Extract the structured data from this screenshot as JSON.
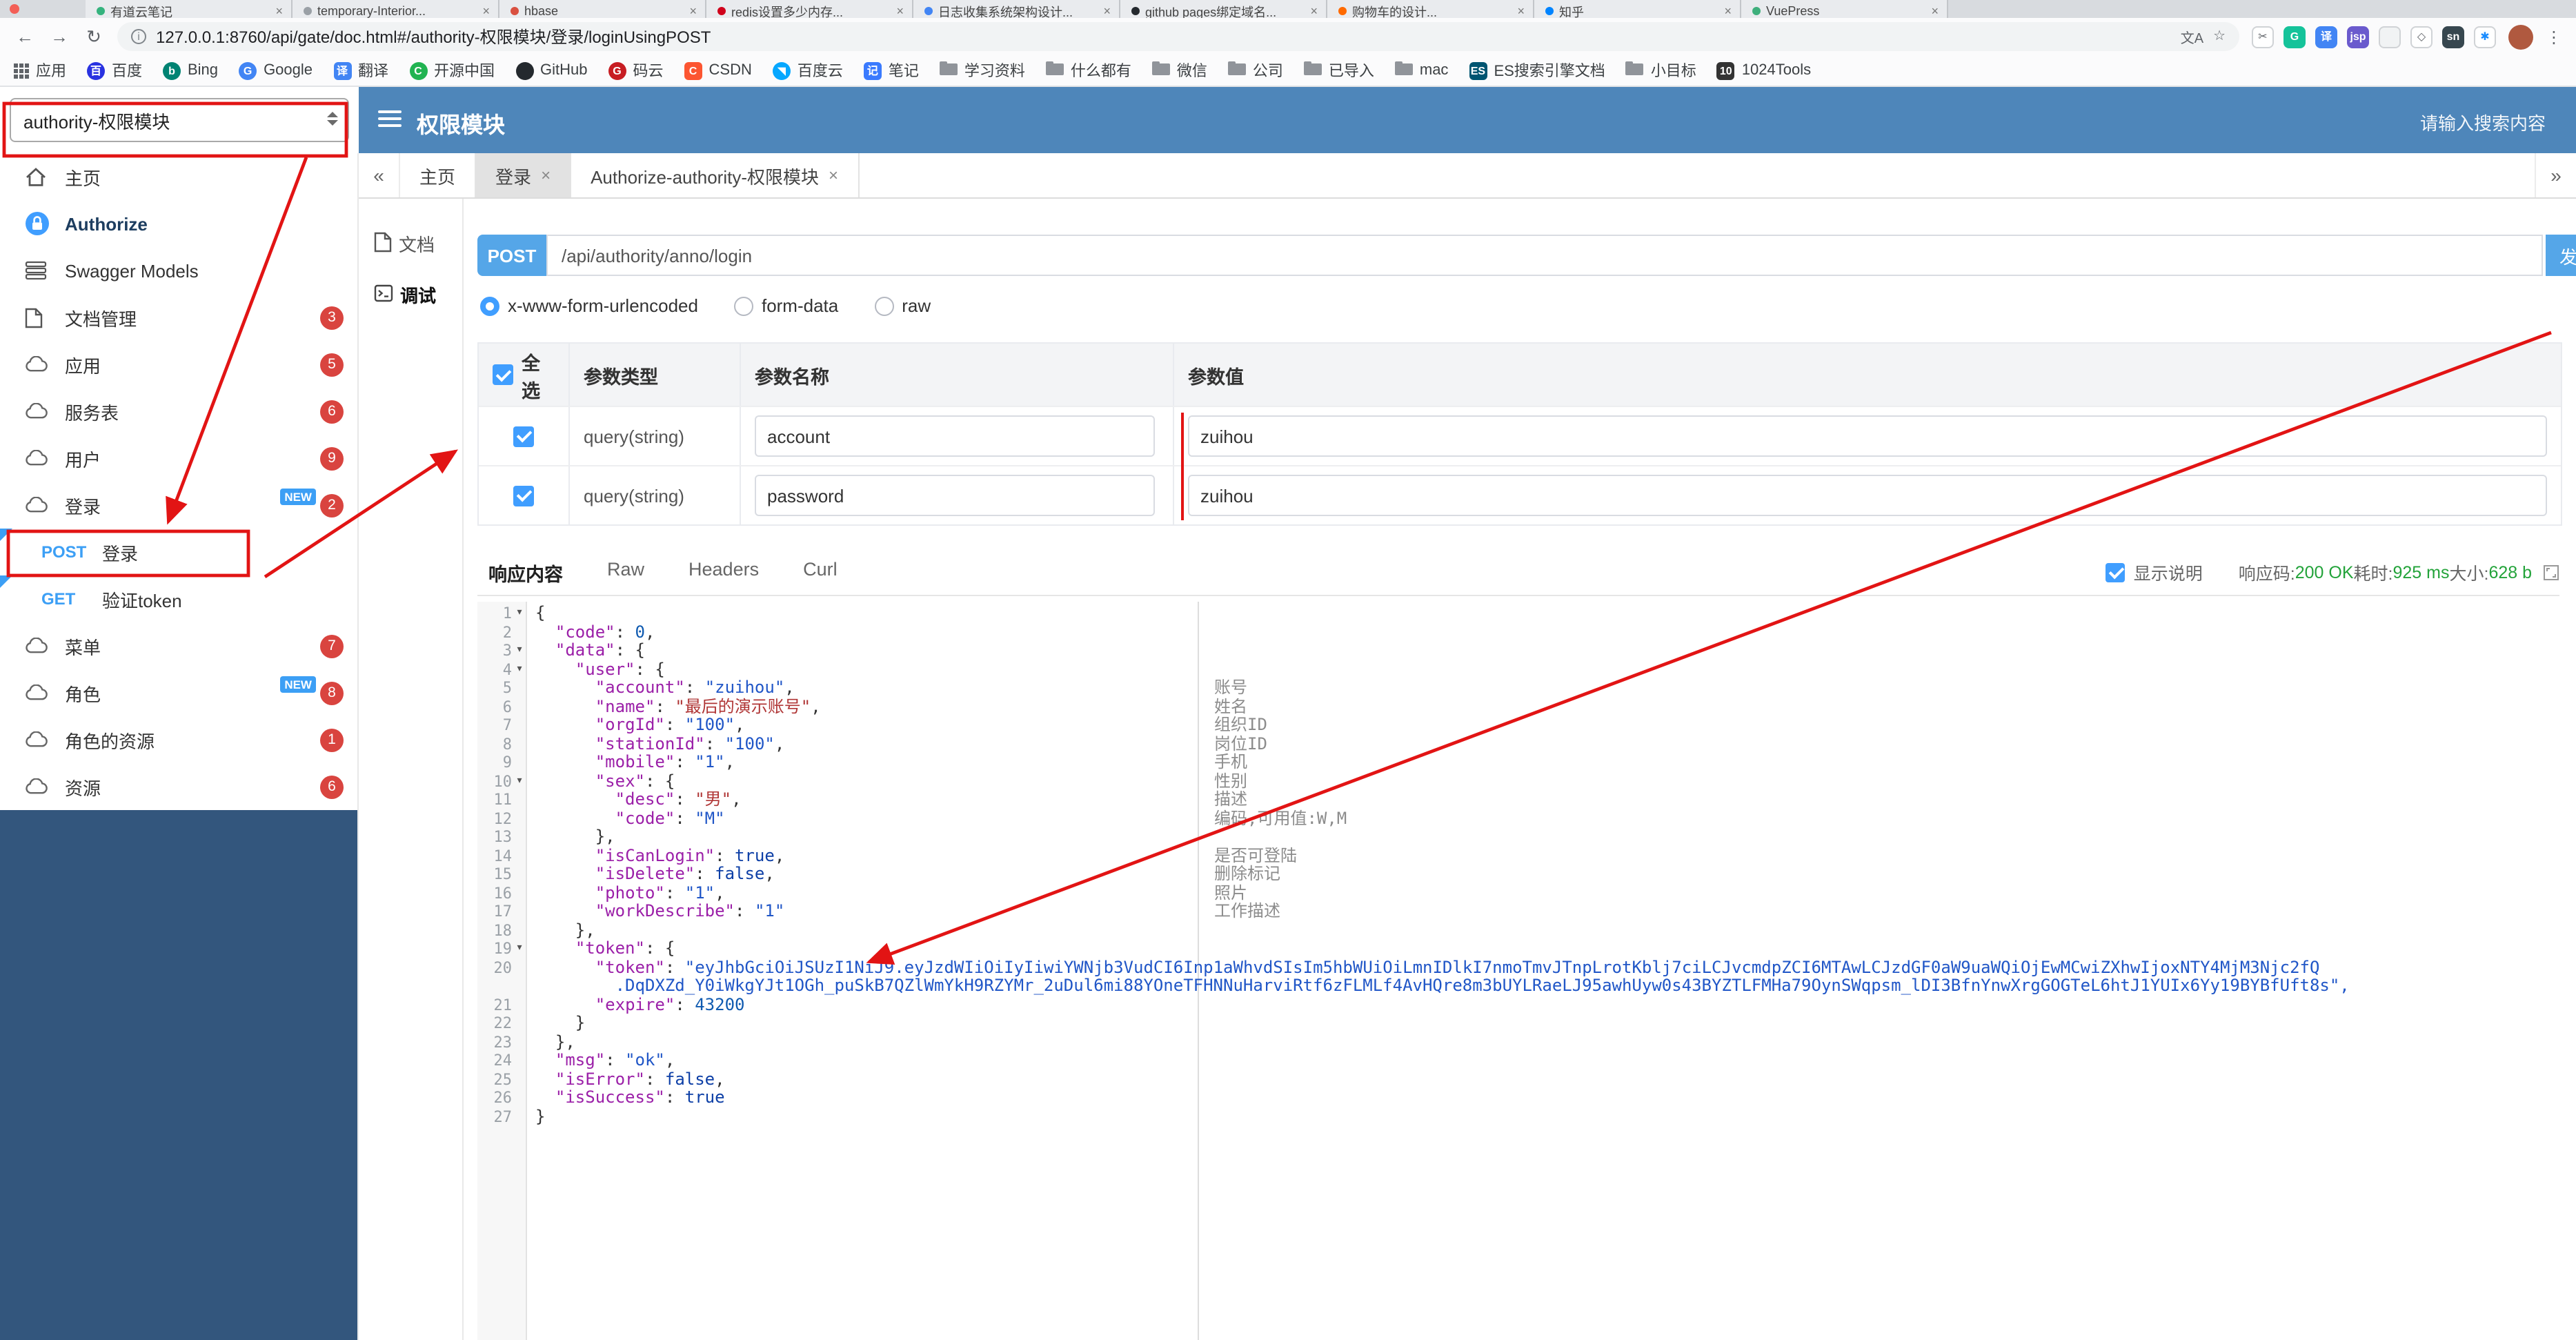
{
  "colors": {
    "accent": "#409eff",
    "post_blue": "#55a6e8",
    "header_bg": "#4e86ba",
    "sidebar_dark": "#33567d",
    "badge_red": "#d9443f",
    "new_blue": "#3c9ff5",
    "annotation_red": "#e21414",
    "success_green": "#23a33a",
    "code_key": "#9b1fa8",
    "code_str": "#2056c7",
    "code_cjk": "#b03636",
    "code_num": "#0f5ab0",
    "code_bool": "#0d3fa6"
  },
  "browser": {
    "url": "127.0.0.1:8760/api/gate/doc.html#/authority-权限模块/登录/loginUsingPOST",
    "tabs": [
      {
        "color": "#35b37e",
        "title": "有道云笔记"
      },
      {
        "color": "#9aa0a6",
        "title": "temporary-Interior..."
      },
      {
        "color": "#d95040",
        "title": "hbase"
      },
      {
        "color": "#d0021b",
        "title": "redis设置多少内存..."
      },
      {
        "color": "#4285f4",
        "title": "日志收集系统架构设计..."
      },
      {
        "color": "#24292e",
        "title": "github pages绑定域名..."
      },
      {
        "color": "#ff6a00",
        "title": "购物车的设计..."
      },
      {
        "color": "#0084ff",
        "title": "知乎"
      },
      {
        "color": "#3eaf7c",
        "title": "VuePress"
      }
    ],
    "toolbar": {
      "back": "←",
      "forward": "→",
      "reload": "↻",
      "translate_icon": "文A",
      "star_icon": "☆",
      "menu_icon": "⋮",
      "extensions": [
        {
          "name": "screenshot-icon",
          "glyph": "✂",
          "bg": "#ffffff",
          "fg": "#5f6368",
          "border": true
        },
        {
          "name": "grammarly-icon",
          "glyph": "G",
          "bg": "#15c39a",
          "fg": "#ffffff"
        },
        {
          "name": "translate-ext-icon",
          "glyph": "译",
          "bg": "#4285f4",
          "fg": "#ffffff"
        },
        {
          "name": "jsp-icon",
          "glyph": "jsp",
          "bg": "#6a5acd",
          "fg": "#ffffff"
        },
        {
          "name": "dot-icon",
          "glyph": "",
          "bg": "#f1f3f4",
          "fg": "#5f6368",
          "border": true
        },
        {
          "name": "shield-icon",
          "glyph": "◇",
          "bg": "#ffffff",
          "fg": "#5f6368",
          "border": true
        },
        {
          "name": "snip-icon",
          "glyph": "sn",
          "bg": "#37474f",
          "fg": "#ffffff"
        },
        {
          "name": "pinwheel-icon",
          "glyph": "✱",
          "bg": "#ffffff",
          "fg": "#1a8cff",
          "border": true
        }
      ]
    },
    "bookmarks": [
      {
        "type": "grid",
        "label": "应用"
      },
      {
        "type": "circle",
        "color": "#2932e1",
        "glyph": "百",
        "label": "百度"
      },
      {
        "type": "circle",
        "color": "#008373",
        "glyph": "b",
        "label": "Bing"
      },
      {
        "type": "circle",
        "color": "#4285f4",
        "glyph": "G",
        "label": "Google"
      },
      {
        "type": "square",
        "color": "#4285f4",
        "glyph": "译",
        "label": "翻译"
      },
      {
        "type": "circle",
        "color": "#21b351",
        "glyph": "C",
        "label": "开源中国"
      },
      {
        "type": "circle",
        "color": "#24292e",
        "glyph": "",
        "label": "GitHub"
      },
      {
        "type": "circle",
        "color": "#c71d23",
        "glyph": "G",
        "label": "码云"
      },
      {
        "type": "square",
        "color": "#fc5531",
        "glyph": "C",
        "label": "CSDN"
      },
      {
        "type": "circle",
        "color": "#06a7ff",
        "glyph": "◥",
        "label": "百度云"
      },
      {
        "type": "square",
        "color": "#3a7afe",
        "glyph": "记",
        "label": "笔记"
      },
      {
        "type": "folder",
        "label": "学习资料"
      },
      {
        "type": "folder",
        "label": "什么都有"
      },
      {
        "type": "folder",
        "label": "微信"
      },
      {
        "type": "folder",
        "label": "公司"
      },
      {
        "type": "folder",
        "label": "已导入"
      },
      {
        "type": "folder",
        "label": "mac"
      },
      {
        "type": "square",
        "color": "#005571",
        "glyph": "ES",
        "label": "ES搜索引擎文档"
      },
      {
        "type": "folder",
        "label": "小目标"
      },
      {
        "type": "square",
        "color": "#333333",
        "glyph": "10",
        "label": "1024Tools"
      }
    ]
  },
  "header": {
    "group_select": "authority-权限模块",
    "title": "权限模块",
    "search_placeholder": "请输入搜索内容"
  },
  "sidebar": {
    "items": [
      {
        "icon": "home",
        "label": "主页"
      },
      {
        "icon": "lock",
        "label": "Authorize",
        "bold": true
      },
      {
        "icon": "models",
        "label": "Swagger Models"
      },
      {
        "icon": "doc",
        "label": "文档管理",
        "badge": "3"
      },
      {
        "icon": "cloud",
        "label": "应用",
        "badge": "5"
      },
      {
        "icon": "cloud",
        "label": "服务表",
        "badge": "6"
      },
      {
        "icon": "cloud",
        "label": "用户",
        "badge": "9"
      },
      {
        "icon": "cloud",
        "label": "登录",
        "badge": "2",
        "new": true
      },
      {
        "type": "api",
        "method": "POST",
        "label": "登录",
        "boxed": true
      },
      {
        "type": "api",
        "method": "GET",
        "label": "验证token"
      },
      {
        "icon": "cloud",
        "label": "菜单",
        "badge": "7"
      },
      {
        "icon": "cloud",
        "label": "角色",
        "badge": "8",
        "new": true
      },
      {
        "icon": "cloud",
        "label": "角色的资源",
        "badge": "1"
      },
      {
        "icon": "cloud",
        "label": "资源",
        "badge": "6"
      }
    ]
  },
  "tabs": {
    "collapse_left": "«",
    "collapse_right": "»",
    "items": [
      {
        "label": "主页"
      },
      {
        "label": "登录",
        "closable": true,
        "active": true
      },
      {
        "label": "Authorize-authority-权限模块",
        "closable": true
      }
    ]
  },
  "doc_nav": [
    {
      "label": "文档",
      "icon": "doc"
    },
    {
      "label": "调试",
      "icon": "debug",
      "active": true
    }
  ],
  "debug": {
    "method": "POST",
    "endpoint": "/api/authority/anno/login",
    "send_label": "发送",
    "content_types": [
      {
        "label": "x-www-form-urlencoded",
        "selected": true
      },
      {
        "label": "form-data"
      },
      {
        "label": "raw"
      }
    ],
    "param_table": {
      "headers": [
        "全选",
        "参数类型",
        "参数名称",
        "参数值"
      ],
      "rows": [
        {
          "checked": true,
          "type": "query(string)",
          "name": "account",
          "value": "zuihou"
        },
        {
          "checked": true,
          "type": "query(string)",
          "name": "password",
          "value": "zuihou"
        }
      ]
    }
  },
  "response": {
    "tabs": [
      "响应内容",
      "Raw",
      "Headers",
      "Curl"
    ],
    "active_tab": "响应内容",
    "show_desc_label": "显示说明",
    "meta": {
      "code_label": "响应码:",
      "code": "200 OK",
      "time_label": "耗时:",
      "time": "925 ms",
      "size_label": "大小:",
      "size": "628 b"
    },
    "editor": {
      "rows": [
        {
          "n": "1",
          "f": true,
          "t": "{"
        },
        {
          "n": "2",
          "t": "  \"code\": 0,"
        },
        {
          "n": "3",
          "f": true,
          "t": "  \"data\": {"
        },
        {
          "n": "4",
          "f": true,
          "t": "    \"user\": {"
        },
        {
          "n": "5",
          "t": "      \"account\": \"zuihou\","
        },
        {
          "n": "6",
          "t": "      \"name\": \"最后的演示账号\","
        },
        {
          "n": "7",
          "t": "      \"orgId\": \"100\","
        },
        {
          "n": "8",
          "t": "      \"stationId\": \"100\","
        },
        {
          "n": "9",
          "t": "      \"mobile\": \"1\","
        },
        {
          "n": "10",
          "f": true,
          "t": "      \"sex\": {"
        },
        {
          "n": "11",
          "t": "        \"desc\": \"男\","
        },
        {
          "n": "12",
          "t": "        \"code\": \"M\""
        },
        {
          "n": "13",
          "t": "      },"
        },
        {
          "n": "14",
          "t": "      \"isCanLogin\": true,"
        },
        {
          "n": "15",
          "t": "      \"isDelete\": false,"
        },
        {
          "n": "16",
          "t": "      \"photo\": \"1\","
        },
        {
          "n": "17",
          "t": "      \"workDescribe\": \"1\""
        },
        {
          "n": "18",
          "t": "    },"
        },
        {
          "n": "19",
          "f": true,
          "t": "    \"token\": {"
        },
        {
          "n": "20",
          "t": "      \"token\": \"eyJhbGciOiJSUzI1NiJ9.eyJzdWIiOiIyIiwiYWNjb3VudCI6Inp1aWhvdSIsIm5hbWUiOiLmnIDlkI7nmoTmvJTnpLrotKblj7ciLCJvcmdpZCI6MTAwLCJzdGF0aW9uaWQiOjEwMCwiZXhwIjoxNTY4MjM3Njc2fQ"
        },
        {
          "n": "",
          "t": "        .DqDXZd_Y0iWkgYJt1OGh_puSkB7QZlWmYkH9RZYMr_2uDul6mi88YOneTFHNNuHarviRtf6zFLMLf4AvHQre8m3bUYLRaeLJ95awhUyw0s43BYZTLFMHa79OynSWqpsm_lDI3BfnYnwXrgGOGTeL6htJ1YUIx6Yy19BYBfUft8s\","
        },
        {
          "n": "21",
          "t": "      \"expire\": 43200"
        },
        {
          "n": "22",
          "t": "    }"
        },
        {
          "n": "23",
          "t": "  },"
        },
        {
          "n": "24",
          "t": "  \"msg\": \"ok\","
        },
        {
          "n": "25",
          "t": "  \"isError\": false,"
        },
        {
          "n": "26",
          "t": "  \"isSuccess\": true"
        },
        {
          "n": "27",
          "t": "}"
        }
      ],
      "annotations": [
        {
          "row": 4,
          "text": "账号"
        },
        {
          "row": 5,
          "text": "姓名"
        },
        {
          "row": 6,
          "text": "组织ID"
        },
        {
          "row": 7,
          "text": "岗位ID"
        },
        {
          "row": 8,
          "text": "手机"
        },
        {
          "row": 9,
          "text": "性别"
        },
        {
          "row": 10,
          "text": "描述"
        },
        {
          "row": 11,
          "text": "编码,可用值:W,M"
        },
        {
          "row": 13,
          "text": "是否可登陆"
        },
        {
          "row": 14,
          "text": "删除标记"
        },
        {
          "row": 15,
          "text": "照片"
        },
        {
          "row": 16,
          "text": "工作描述"
        }
      ]
    }
  }
}
